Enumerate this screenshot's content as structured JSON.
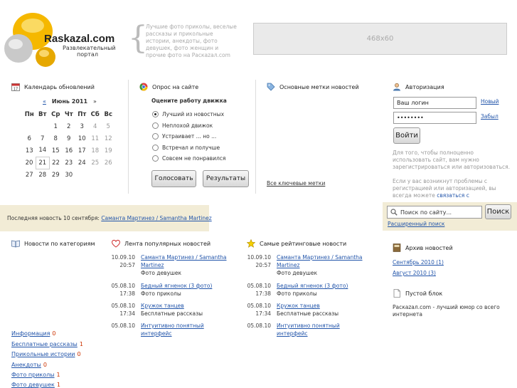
{
  "header": {
    "logo_text": "Raskazal.com",
    "logo_subtitle_1": "Развлекательный",
    "logo_subtitle_2": "портал",
    "tagline": "Лучшие фото приколы, веселые рассказы и прикольные истории, анекдоты, фото девушек, фото женщин и прочие фото на Раскazал.com",
    "banner_text": "468x60"
  },
  "calendar": {
    "title": "Календарь обновлений",
    "prev": "«",
    "month": "Июнь 2011",
    "next": "»",
    "weekdays": [
      "Пн",
      "Вт",
      "Ср",
      "Чт",
      "Пт",
      "Сб",
      "Вс"
    ],
    "weeks": [
      [
        "",
        "",
        "1",
        "2",
        "3",
        "4",
        "5"
      ],
      [
        "6",
        "7",
        "8",
        "9",
        "10",
        "11",
        "12"
      ],
      [
        "13",
        "14",
        "15",
        "16",
        "17",
        "18",
        "19"
      ],
      [
        "20",
        "21",
        "22",
        "23",
        "24",
        "25",
        "26"
      ],
      [
        "27",
        "28",
        "29",
        "30",
        "",
        "",
        ""
      ]
    ],
    "today": "21"
  },
  "poll": {
    "title": "Опрос на сайте",
    "question": "Оцените работу движка",
    "options": [
      "Лучший из новостных",
      "Неплохой движок",
      "Устраивает ... но ...",
      "Встречал и получше",
      "Совсем не понравился"
    ],
    "vote_label": "Голосовать",
    "results_label": "Результаты"
  },
  "tags": {
    "title": "Основные метки новостей",
    "all_tags": "Все ключевые метки"
  },
  "auth": {
    "title": "Авторизация",
    "login_value": "Ваш логин",
    "password_value": "••••••••",
    "new_link": "Новый",
    "forgot_link": "Забыл",
    "login_button": "Войти",
    "note1": "Для того, чтобы полноценно использовать сайт, вам нужно зарегистрироваться или авторизоваться.",
    "note2_prefix": "Если у вас возникнут проблемы с регистрацией или авторизацией, вы всегда можете ",
    "note2_link": "связаться с администрацией"
  },
  "last_news": {
    "prefix": "Последняя новость 10 сентября: ",
    "link": "Саманта Мартинез / Samantha Martinez"
  },
  "search": {
    "placeholder": "Поиск по сайту...",
    "button": "Поиск",
    "advanced": "Расширенный поиск"
  },
  "categories": {
    "title": "Новости по категориям",
    "items": [
      {
        "name": "Информация",
        "count": "0"
      },
      {
        "name": "Бесплатные рассказы",
        "count": "1"
      },
      {
        "name": "Прикольные истории",
        "count": "0"
      },
      {
        "name": "Анекдоты",
        "count": "0"
      },
      {
        "name": "Фото приколы",
        "count": "1"
      },
      {
        "name": "Фото девушек",
        "count": "1"
      }
    ]
  },
  "popular": {
    "title": "Лента популярных новостей",
    "items": [
      {
        "date": "10.09.10",
        "time": "20:57",
        "title": "Саманта Мартинез / Samantha Martinez",
        "category": "Фото девушек"
      },
      {
        "date": "05.08.10",
        "time": "17:38",
        "title": "Бедный ягненок (3 фото)",
        "category": "Фото приколы"
      },
      {
        "date": "05.08.10",
        "time": "17:34",
        "title": "Кружок танцев",
        "category": "Бесплатные рассказы"
      },
      {
        "date": "05.08.10",
        "time": "",
        "title": "Интуитивно понятный интерфейс",
        "category": ""
      }
    ]
  },
  "top_rated": {
    "title": "Самые рейтинговые новости",
    "items": [
      {
        "date": "10.09.10",
        "time": "20:57",
        "title": "Саманта Мартинез / Samantha Martinez",
        "category": "Фото девушек"
      },
      {
        "date": "05.08.10",
        "time": "17:38",
        "title": "Бедный ягненок (3 фото)",
        "category": "Фото приколы"
      },
      {
        "date": "05.08.10",
        "time": "17:34",
        "title": "Кружок танцев",
        "category": "Бесплатные рассказы"
      },
      {
        "date": "05.08.10",
        "time": "",
        "title": "Интуитивно понятный интерфейс",
        "category": ""
      }
    ]
  },
  "archive": {
    "title": "Архив новостей",
    "items": [
      "Сентябрь 2010 (1)",
      "Август 2010 (3)"
    ]
  },
  "empty_block": {
    "title": "Пустой блок",
    "text": "Раскazал.com - лучший юмор со всего интернета"
  },
  "colors": {
    "band": "#f2ecd6",
    "link": "#2255aa",
    "count": "#cc3300",
    "logo_yellow": "#f5b800"
  }
}
